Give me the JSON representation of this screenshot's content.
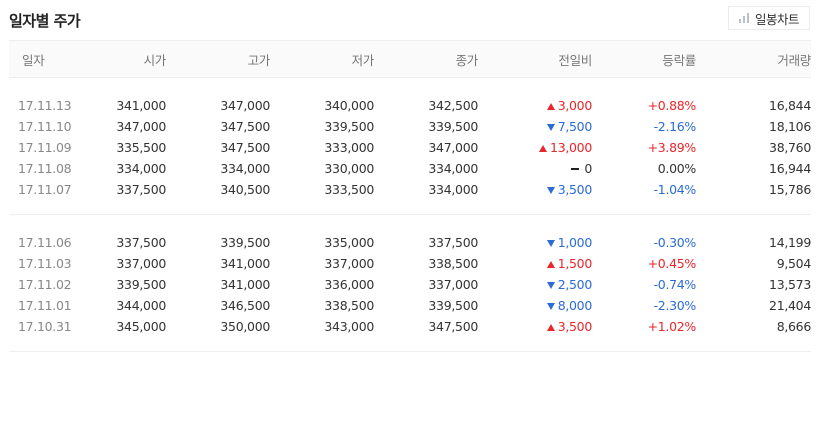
{
  "header": {
    "title": "일자별 주가",
    "chart_button_label": "일봉차트",
    "chart_button_icon": "bar-chart-icon"
  },
  "table": {
    "columns": [
      "일자",
      "시가",
      "고가",
      "저가",
      "종가",
      "전일비",
      "등락률",
      "거래량"
    ],
    "groups": [
      [
        {
          "date": "17.11.13",
          "open": "341,000",
          "high": "347,000",
          "low": "340,000",
          "close": "342,500",
          "direction": "up",
          "change": "3,000",
          "rate": "+0.88%",
          "volume": "16,844"
        },
        {
          "date": "17.11.10",
          "open": "347,000",
          "high": "347,500",
          "low": "339,500",
          "close": "339,500",
          "direction": "down",
          "change": "7,500",
          "rate": "-2.16%",
          "volume": "18,106"
        },
        {
          "date": "17.11.09",
          "open": "335,500",
          "high": "347,500",
          "low": "333,000",
          "close": "347,000",
          "direction": "up",
          "change": "13,000",
          "rate": "+3.89%",
          "volume": "38,760"
        },
        {
          "date": "17.11.08",
          "open": "334,000",
          "high": "334,000",
          "low": "330,000",
          "close": "334,000",
          "direction": "flat",
          "change": "0",
          "rate": "0.00%",
          "volume": "16,944"
        },
        {
          "date": "17.11.07",
          "open": "337,500",
          "high": "340,500",
          "low": "333,500",
          "close": "334,000",
          "direction": "down",
          "change": "3,500",
          "rate": "-1.04%",
          "volume": "15,786"
        }
      ],
      [
        {
          "date": "17.11.06",
          "open": "337,500",
          "high": "339,500",
          "low": "335,000",
          "close": "337,500",
          "direction": "down",
          "change": "1,000",
          "rate": "-0.30%",
          "volume": "14,199"
        },
        {
          "date": "17.11.03",
          "open": "337,000",
          "high": "341,000",
          "low": "337,000",
          "close": "338,500",
          "direction": "up",
          "change": "1,500",
          "rate": "+0.45%",
          "volume": "9,504"
        },
        {
          "date": "17.11.02",
          "open": "339,500",
          "high": "341,000",
          "low": "336,000",
          "close": "337,000",
          "direction": "down",
          "change": "2,500",
          "rate": "-0.74%",
          "volume": "13,573"
        },
        {
          "date": "17.11.01",
          "open": "344,000",
          "high": "346,500",
          "low": "338,500",
          "close": "339,500",
          "direction": "down",
          "change": "8,000",
          "rate": "-2.30%",
          "volume": "21,404"
        },
        {
          "date": "17.10.31",
          "open": "345,000",
          "high": "350,000",
          "low": "343,000",
          "close": "347,500",
          "direction": "up",
          "change": "3,500",
          "rate": "+1.02%",
          "volume": "8,666"
        }
      ]
    ]
  },
  "colors": {
    "up": "#e8262b",
    "down": "#2b6bd6"
  }
}
